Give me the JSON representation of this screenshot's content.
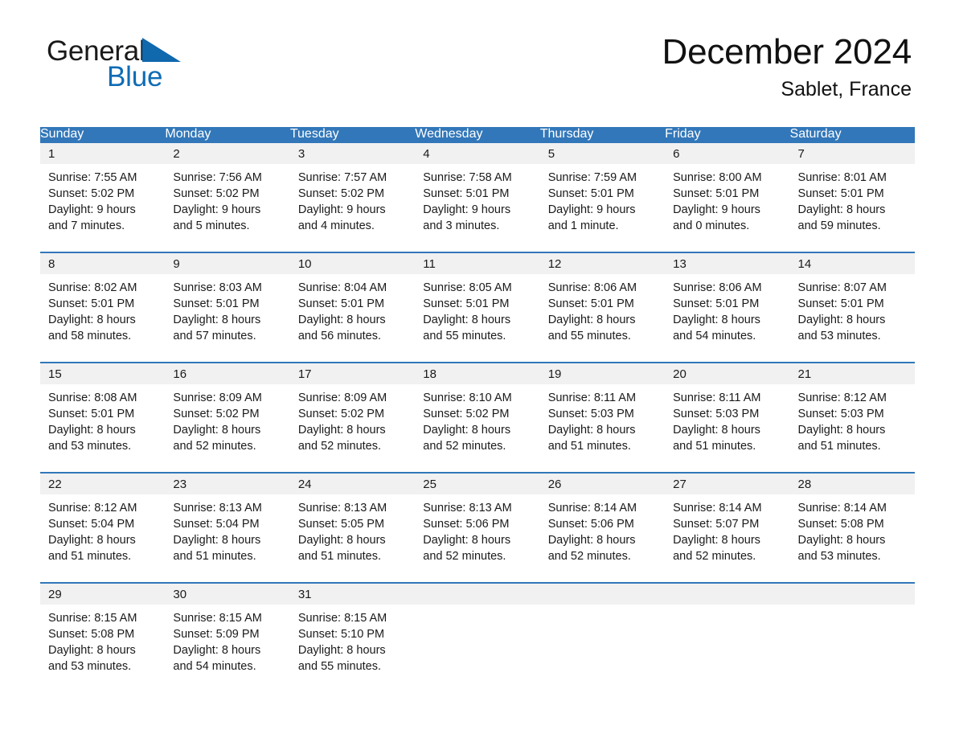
{
  "brand": {
    "word1": "General",
    "word2": "Blue",
    "triangle_color": "#1068ad",
    "word2_color": "#0f6cb5"
  },
  "header": {
    "title": "December 2024",
    "location": "Sablet, France"
  },
  "theme": {
    "header_blue": "#3277b9",
    "daynum_gray": "#f1f1f1",
    "text": "#1a1a1a"
  },
  "calendar": {
    "weekday_headers": [
      "Sunday",
      "Monday",
      "Tuesday",
      "Wednesday",
      "Thursday",
      "Friday",
      "Saturday"
    ],
    "weeks": [
      [
        {
          "day": "1",
          "sunrise": "Sunrise: 7:55 AM",
          "sunset": "Sunset: 5:02 PM",
          "daylight_line1": "Daylight: 9 hours",
          "daylight_line2": "and 7 minutes."
        },
        {
          "day": "2",
          "sunrise": "Sunrise: 7:56 AM",
          "sunset": "Sunset: 5:02 PM",
          "daylight_line1": "Daylight: 9 hours",
          "daylight_line2": "and 5 minutes."
        },
        {
          "day": "3",
          "sunrise": "Sunrise: 7:57 AM",
          "sunset": "Sunset: 5:02 PM",
          "daylight_line1": "Daylight: 9 hours",
          "daylight_line2": "and 4 minutes."
        },
        {
          "day": "4",
          "sunrise": "Sunrise: 7:58 AM",
          "sunset": "Sunset: 5:01 PM",
          "daylight_line1": "Daylight: 9 hours",
          "daylight_line2": "and 3 minutes."
        },
        {
          "day": "5",
          "sunrise": "Sunrise: 7:59 AM",
          "sunset": "Sunset: 5:01 PM",
          "daylight_line1": "Daylight: 9 hours",
          "daylight_line2": "and 1 minute."
        },
        {
          "day": "6",
          "sunrise": "Sunrise: 8:00 AM",
          "sunset": "Sunset: 5:01 PM",
          "daylight_line1": "Daylight: 9 hours",
          "daylight_line2": "and 0 minutes."
        },
        {
          "day": "7",
          "sunrise": "Sunrise: 8:01 AM",
          "sunset": "Sunset: 5:01 PM",
          "daylight_line1": "Daylight: 8 hours",
          "daylight_line2": "and 59 minutes."
        }
      ],
      [
        {
          "day": "8",
          "sunrise": "Sunrise: 8:02 AM",
          "sunset": "Sunset: 5:01 PM",
          "daylight_line1": "Daylight: 8 hours",
          "daylight_line2": "and 58 minutes."
        },
        {
          "day": "9",
          "sunrise": "Sunrise: 8:03 AM",
          "sunset": "Sunset: 5:01 PM",
          "daylight_line1": "Daylight: 8 hours",
          "daylight_line2": "and 57 minutes."
        },
        {
          "day": "10",
          "sunrise": "Sunrise: 8:04 AM",
          "sunset": "Sunset: 5:01 PM",
          "daylight_line1": "Daylight: 8 hours",
          "daylight_line2": "and 56 minutes."
        },
        {
          "day": "11",
          "sunrise": "Sunrise: 8:05 AM",
          "sunset": "Sunset: 5:01 PM",
          "daylight_line1": "Daylight: 8 hours",
          "daylight_line2": "and 55 minutes."
        },
        {
          "day": "12",
          "sunrise": "Sunrise: 8:06 AM",
          "sunset": "Sunset: 5:01 PM",
          "daylight_line1": "Daylight: 8 hours",
          "daylight_line2": "and 55 minutes."
        },
        {
          "day": "13",
          "sunrise": "Sunrise: 8:06 AM",
          "sunset": "Sunset: 5:01 PM",
          "daylight_line1": "Daylight: 8 hours",
          "daylight_line2": "and 54 minutes."
        },
        {
          "day": "14",
          "sunrise": "Sunrise: 8:07 AM",
          "sunset": "Sunset: 5:01 PM",
          "daylight_line1": "Daylight: 8 hours",
          "daylight_line2": "and 53 minutes."
        }
      ],
      [
        {
          "day": "15",
          "sunrise": "Sunrise: 8:08 AM",
          "sunset": "Sunset: 5:01 PM",
          "daylight_line1": "Daylight: 8 hours",
          "daylight_line2": "and 53 minutes."
        },
        {
          "day": "16",
          "sunrise": "Sunrise: 8:09 AM",
          "sunset": "Sunset: 5:02 PM",
          "daylight_line1": "Daylight: 8 hours",
          "daylight_line2": "and 52 minutes."
        },
        {
          "day": "17",
          "sunrise": "Sunrise: 8:09 AM",
          "sunset": "Sunset: 5:02 PM",
          "daylight_line1": "Daylight: 8 hours",
          "daylight_line2": "and 52 minutes."
        },
        {
          "day": "18",
          "sunrise": "Sunrise: 8:10 AM",
          "sunset": "Sunset: 5:02 PM",
          "daylight_line1": "Daylight: 8 hours",
          "daylight_line2": "and 52 minutes."
        },
        {
          "day": "19",
          "sunrise": "Sunrise: 8:11 AM",
          "sunset": "Sunset: 5:03 PM",
          "daylight_line1": "Daylight: 8 hours",
          "daylight_line2": "and 51 minutes."
        },
        {
          "day": "20",
          "sunrise": "Sunrise: 8:11 AM",
          "sunset": "Sunset: 5:03 PM",
          "daylight_line1": "Daylight: 8 hours",
          "daylight_line2": "and 51 minutes."
        },
        {
          "day": "21",
          "sunrise": "Sunrise: 8:12 AM",
          "sunset": "Sunset: 5:03 PM",
          "daylight_line1": "Daylight: 8 hours",
          "daylight_line2": "and 51 minutes."
        }
      ],
      [
        {
          "day": "22",
          "sunrise": "Sunrise: 8:12 AM",
          "sunset": "Sunset: 5:04 PM",
          "daylight_line1": "Daylight: 8 hours",
          "daylight_line2": "and 51 minutes."
        },
        {
          "day": "23",
          "sunrise": "Sunrise: 8:13 AM",
          "sunset": "Sunset: 5:04 PM",
          "daylight_line1": "Daylight: 8 hours",
          "daylight_line2": "and 51 minutes."
        },
        {
          "day": "24",
          "sunrise": "Sunrise: 8:13 AM",
          "sunset": "Sunset: 5:05 PM",
          "daylight_line1": "Daylight: 8 hours",
          "daylight_line2": "and 51 minutes."
        },
        {
          "day": "25",
          "sunrise": "Sunrise: 8:13 AM",
          "sunset": "Sunset: 5:06 PM",
          "daylight_line1": "Daylight: 8 hours",
          "daylight_line2": "and 52 minutes."
        },
        {
          "day": "26",
          "sunrise": "Sunrise: 8:14 AM",
          "sunset": "Sunset: 5:06 PM",
          "daylight_line1": "Daylight: 8 hours",
          "daylight_line2": "and 52 minutes."
        },
        {
          "day": "27",
          "sunrise": "Sunrise: 8:14 AM",
          "sunset": "Sunset: 5:07 PM",
          "daylight_line1": "Daylight: 8 hours",
          "daylight_line2": "and 52 minutes."
        },
        {
          "day": "28",
          "sunrise": "Sunrise: 8:14 AM",
          "sunset": "Sunset: 5:08 PM",
          "daylight_line1": "Daylight: 8 hours",
          "daylight_line2": "and 53 minutes."
        }
      ],
      [
        {
          "day": "29",
          "sunrise": "Sunrise: 8:15 AM",
          "sunset": "Sunset: 5:08 PM",
          "daylight_line1": "Daylight: 8 hours",
          "daylight_line2": "and 53 minutes."
        },
        {
          "day": "30",
          "sunrise": "Sunrise: 8:15 AM",
          "sunset": "Sunset: 5:09 PM",
          "daylight_line1": "Daylight: 8 hours",
          "daylight_line2": "and 54 minutes."
        },
        {
          "day": "31",
          "sunrise": "Sunrise: 8:15 AM",
          "sunset": "Sunset: 5:10 PM",
          "daylight_line1": "Daylight: 8 hours",
          "daylight_line2": "and 55 minutes."
        },
        {
          "day": "",
          "sunrise": "",
          "sunset": "",
          "daylight_line1": "",
          "daylight_line2": ""
        },
        {
          "day": "",
          "sunrise": "",
          "sunset": "",
          "daylight_line1": "",
          "daylight_line2": ""
        },
        {
          "day": "",
          "sunrise": "",
          "sunset": "",
          "daylight_line1": "",
          "daylight_line2": ""
        },
        {
          "day": "",
          "sunrise": "",
          "sunset": "",
          "daylight_line1": "",
          "daylight_line2": ""
        }
      ]
    ]
  }
}
